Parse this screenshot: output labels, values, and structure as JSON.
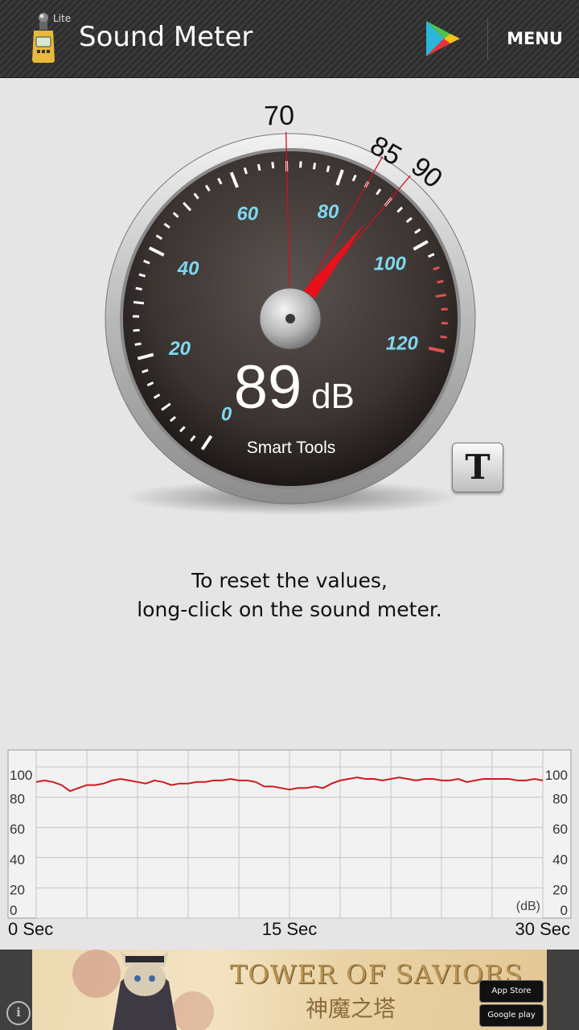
{
  "app": {
    "title": "Sound Meter",
    "edition": "Lite",
    "menu_label": "MENU"
  },
  "meter": {
    "reading": "89",
    "unit": "dB",
    "brand": "Smart Tools",
    "scale_labels": [
      "0",
      "20",
      "40",
      "60",
      "80",
      "100",
      "120"
    ],
    "markers": [
      "70",
      "85",
      "90"
    ],
    "needle_value": 89,
    "tool_button_label": "T",
    "colors": {
      "needle": "#e8101a",
      "scale_label": "#7fd8f0",
      "marker_line": "#d01020",
      "warning_tick": "#e05050"
    }
  },
  "hint": {
    "line1": "To reset the values,",
    "line2": "long-click on the sound meter."
  },
  "history_chart": {
    "unit_label": "(dB)",
    "x_labels": [
      "0 Sec",
      "15 Sec",
      "30 Sec"
    ]
  },
  "chart_data": {
    "type": "line",
    "x": [
      0,
      0.5,
      1,
      1.5,
      2,
      2.5,
      3,
      3.5,
      4,
      4.5,
      5,
      5.5,
      6,
      6.5,
      7,
      7.5,
      8,
      8.5,
      9,
      9.5,
      10,
      10.5,
      11,
      11.5,
      12,
      12.5,
      13,
      13.5,
      14,
      14.5,
      15,
      15.5,
      16,
      16.5,
      17,
      17.5,
      18,
      18.5,
      19,
      19.5,
      20,
      20.5,
      21,
      21.5,
      22,
      22.5,
      23,
      23.5,
      24,
      24.5,
      25,
      25.5,
      26,
      26.5,
      27,
      27.5,
      28,
      28.5,
      29,
      29.5,
      30
    ],
    "series": [
      {
        "values": [
          90,
          91,
          90,
          88,
          84,
          86,
          88,
          88,
          89,
          91,
          92,
          91,
          90,
          89,
          91,
          90,
          88,
          89,
          89,
          90,
          90,
          91,
          91,
          92,
          91,
          91,
          90,
          87,
          87,
          86,
          85,
          86,
          86,
          87,
          86,
          89,
          91,
          92,
          93,
          92,
          92,
          91,
          92,
          93,
          92,
          91,
          92,
          92,
          91,
          91,
          92,
          90,
          91,
          92,
          92,
          92,
          92,
          91,
          91,
          92,
          91
        ]
      }
    ],
    "xlabel": "",
    "ylabel": "(dB)",
    "x_ticks": [
      "0 Sec",
      "15 Sec",
      "30 Sec"
    ],
    "y_ticks": [
      0,
      20,
      40,
      60,
      80,
      100
    ],
    "ylim": [
      0,
      100
    ],
    "xlim": [
      0,
      30
    ],
    "grid": true,
    "line_color": "#d0191f"
  },
  "ad": {
    "title": "TOWER OF SAVIORS",
    "subtitle": "神魔之塔",
    "app_store_label": "App Store",
    "google_play_label": "Google play",
    "info_icon": "i"
  }
}
